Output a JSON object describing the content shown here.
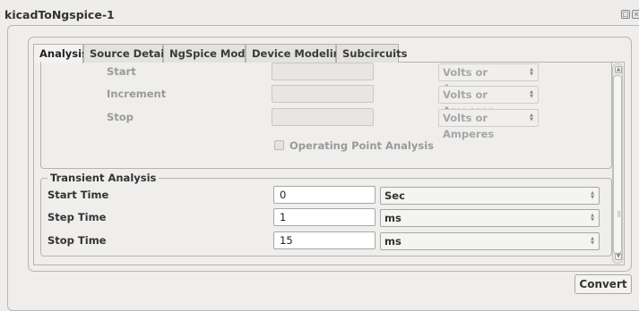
{
  "window": {
    "title": "kicadToNgspice-1"
  },
  "tabs": [
    {
      "label": "Analysis",
      "active": true
    },
    {
      "label": "Source Details",
      "active": false
    },
    {
      "label": "NgSpice Model",
      "active": false
    },
    {
      "label": "Device Modeling",
      "active": false
    },
    {
      "label": "Subcircuits",
      "active": false
    }
  ],
  "dc_analysis": {
    "rows": [
      {
        "label": "Start",
        "value": "",
        "unit": "Volts or Amperes"
      },
      {
        "label": "Increment",
        "value": "",
        "unit": "Volts or Amperes"
      },
      {
        "label": "Stop",
        "value": "",
        "unit": "Volts or Amperes"
      }
    ],
    "operating_point_label": "Operating Point Analysis",
    "operating_point_checked": false
  },
  "transient": {
    "title": "Transient Analysis",
    "rows": [
      {
        "label": "Start Time",
        "value": "0",
        "unit": "Sec"
      },
      {
        "label": "Step Time",
        "value": "1",
        "unit": "ms"
      },
      {
        "label": "Stop Time",
        "value": "15",
        "unit": "ms"
      }
    ]
  },
  "convert_label": "Convert"
}
